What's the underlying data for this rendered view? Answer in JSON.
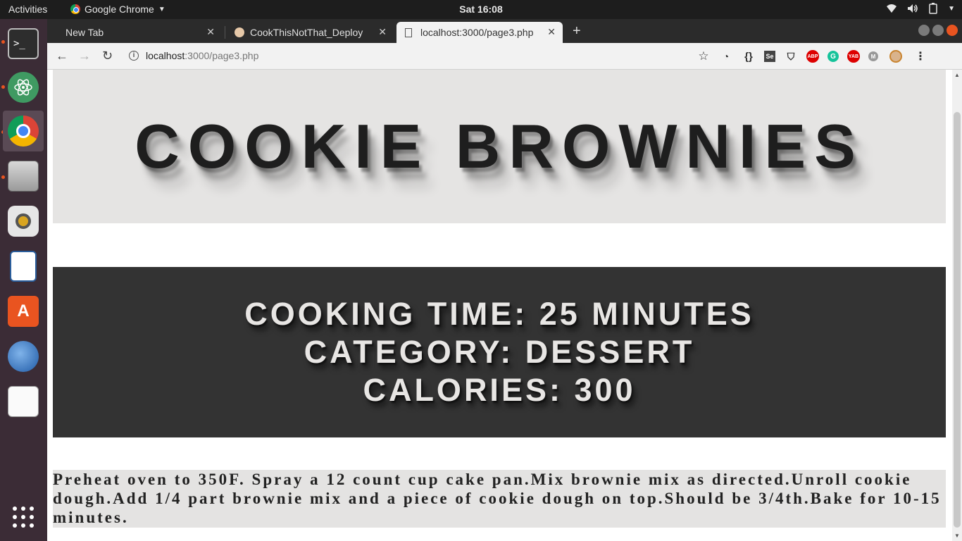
{
  "system": {
    "activities": "Activities",
    "app_name": "Google Chrome",
    "clock": "Sat 16:08"
  },
  "browser": {
    "tabs": [
      {
        "label": "New Tab"
      },
      {
        "label": "CookThisNotThat_Deploy"
      },
      {
        "label": "localhost:3000/page3.php"
      }
    ],
    "url_host": "localhost",
    "url_path": ":3000/page3.php",
    "extensions": [
      "ABP",
      "YAB",
      "M"
    ]
  },
  "page": {
    "title": "COOKIE BROWNIES",
    "info_lines": [
      "COOKING TIME: 25 MINUTES",
      "CATEGORY: DESSERT",
      "CALORIES: 300"
    ],
    "description": "Preheat oven to 350F. Spray a 12 count cup cake pan.Mix brownie mix as directed.Unroll cookie dough.Add 1/4 part brownie mix and a piece of cookie dough on top.Should be 3/4th.Bake for 10-15 minutes."
  }
}
